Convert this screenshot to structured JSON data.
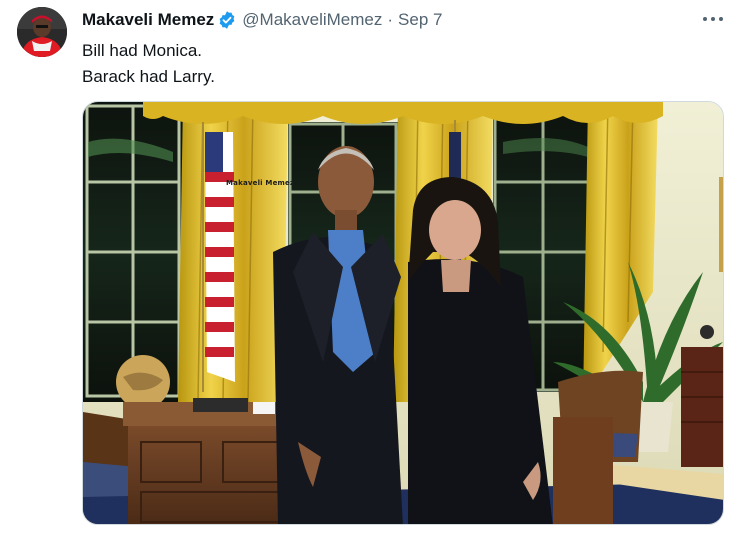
{
  "author": {
    "display_name": "Makaveli Memez",
    "handle": "@MakaveliMemez",
    "separator": "·",
    "date": "Sep 7",
    "verified": true
  },
  "tweet": {
    "lines": [
      "Bill had Monica.",
      "Barack had Larry."
    ]
  },
  "media": {
    "watermark": "Makaveli Memez"
  },
  "icons": {
    "verified": "verified-badge-icon",
    "more": "more-options-icon"
  },
  "colors": {
    "verified_blue": "#1d9bf0",
    "secondary_text": "#536471",
    "primary_text": "#0f1419"
  }
}
